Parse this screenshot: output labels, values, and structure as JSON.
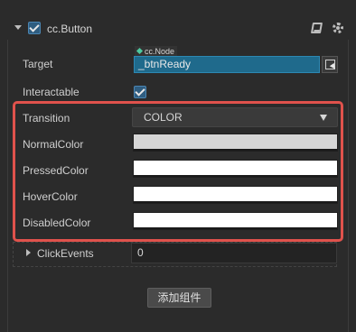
{
  "component": {
    "title": "cc.Button",
    "enabled": true
  },
  "target": {
    "label": "Target",
    "type_tag": "cc.Node",
    "value": "_btnReady"
  },
  "interactable": {
    "label": "Interactable",
    "checked": true
  },
  "transition": {
    "label": "Transition",
    "value": "COLOR"
  },
  "colors": [
    {
      "label": "NormalColor",
      "value": "#d6d6d6"
    },
    {
      "label": "PressedColor",
      "value": "#ffffff"
    },
    {
      "label": "HoverColor",
      "value": "#ffffff"
    },
    {
      "label": "DisabledColor",
      "value": "#ffffff"
    }
  ],
  "click_events": {
    "label": "ClickEvents",
    "count": "0"
  },
  "add_component_label": "添加组件",
  "icons": {
    "expand": "chevron-down-icon",
    "collapse": "chevron-right-icon",
    "help": "book-icon",
    "settings": "gear-icon",
    "node_picker": "node-picker-icon",
    "dropdown": "triangle-down-icon"
  },
  "theme": {
    "highlight": "#e0524c",
    "node_field": "#1f6a8c",
    "checkbox": "#2f5d80"
  }
}
